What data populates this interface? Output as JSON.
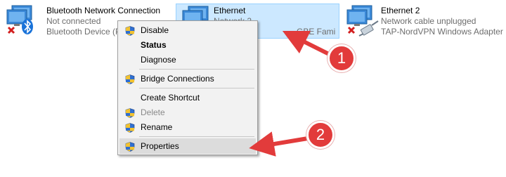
{
  "adapters": {
    "bluetooth": {
      "name": "Bluetooth Network Connection",
      "status": "Not connected",
      "device": "Bluetooth Device (Pe",
      "icon": "bluetooth-network-icon"
    },
    "ethernet": {
      "name": "Ethernet",
      "status": "Network 2",
      "device": "GBE Family Controller",
      "icon": "ethernet-network-icon"
    },
    "ethernet2": {
      "name": "Ethernet 2",
      "status": "Network cable unplugged",
      "device": "TAP-NordVPN Windows Adapter ...",
      "icon": "network-cable-unplugged-icon"
    }
  },
  "context_menu": {
    "items": {
      "disable": "Disable",
      "status": "Status",
      "diagnose": "Diagnose",
      "bridge": "Bridge Connections",
      "shortcut": "Create Shortcut",
      "delete": "Delete",
      "rename": "Rename",
      "properties": "Properties"
    }
  },
  "annotations": {
    "callout_1": "1",
    "callout_2": "2"
  },
  "colors": {
    "selection_bg": "#cce8ff",
    "menu_bg": "#f2f2f2",
    "annotation_red": "#e23b3b",
    "error_red": "#d21f1f",
    "bluetooth_blue": "#1a73d9"
  }
}
